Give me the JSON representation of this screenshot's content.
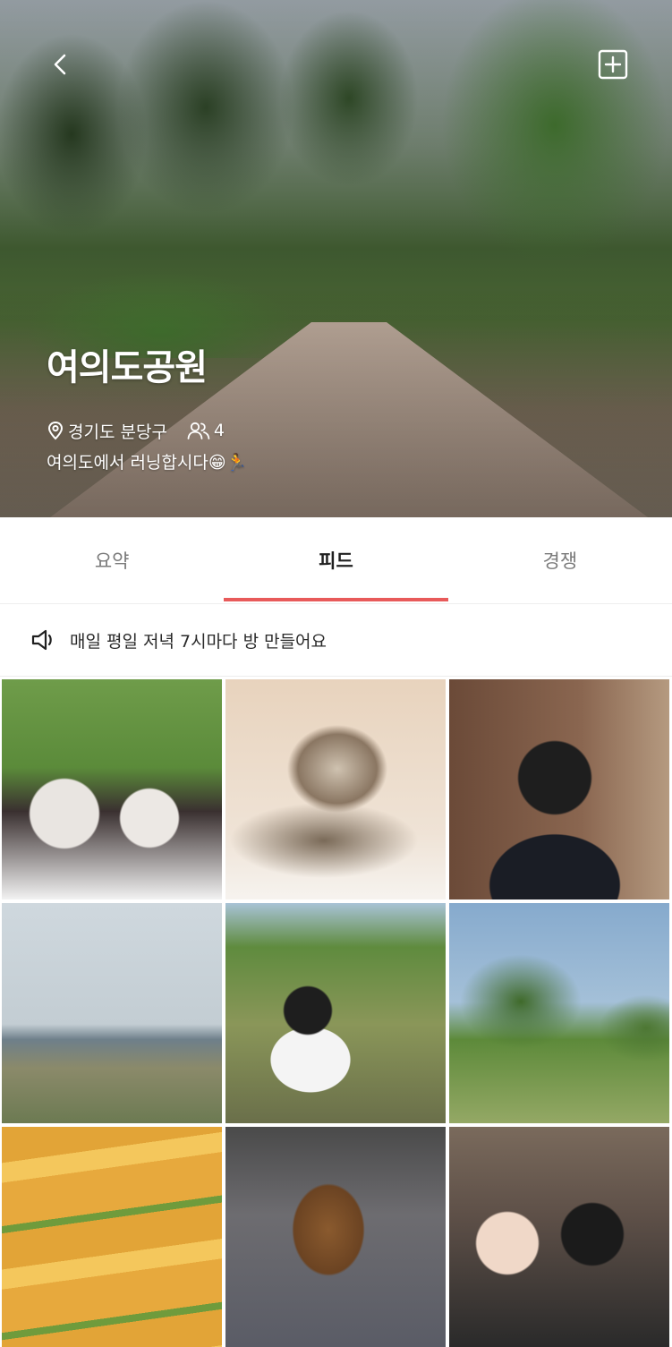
{
  "hero": {
    "title": "여의도공원",
    "location": "경기도 분당구",
    "member_count": "4",
    "description": "여의도에서 러닝합시다😁🏃",
    "back_icon": "chevron-left-icon",
    "add_icon": "plus-square-icon"
  },
  "tabs": [
    {
      "label": "요약",
      "active": false
    },
    {
      "label": "피드",
      "active": true
    },
    {
      "label": "경쟁",
      "active": false
    }
  ],
  "notice": {
    "icon": "speaker-icon",
    "text": "매일 평일 저녁 7시마다 방 만들어요"
  },
  "colors": {
    "accent": "#e85a5a",
    "active_tab_text": "#1f1f1f",
    "inactive_tab_text": "#7a7a7a"
  },
  "feed": {
    "photo_count": 9
  }
}
